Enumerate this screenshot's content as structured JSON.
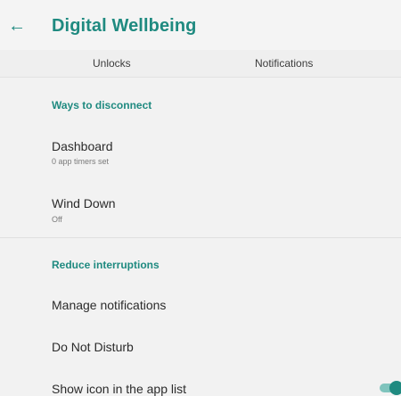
{
  "app_bar": {
    "back_icon": "arrow-back-icon",
    "title": "Digital Wellbeing"
  },
  "tabs": [
    {
      "label": "Unlocks"
    },
    {
      "label": "Notifications"
    }
  ],
  "sections": [
    {
      "header": "Ways to disconnect",
      "items": [
        {
          "title": "Dashboard",
          "subtitle": "0 app timers set"
        },
        {
          "title": "Wind Down",
          "subtitle": "Off"
        }
      ]
    },
    {
      "header": "Reduce interruptions",
      "items": [
        {
          "title": "Manage notifications"
        },
        {
          "title": "Do Not Disturb"
        },
        {
          "title": "Show icon in the app list",
          "toggle": "on"
        }
      ]
    }
  ],
  "colors": {
    "accent": "#1f8a80",
    "background": "#f2f2f2"
  }
}
